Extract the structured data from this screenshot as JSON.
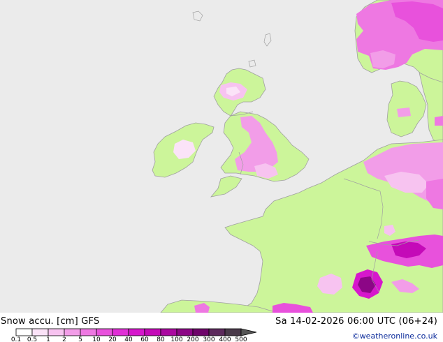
{
  "map": {
    "title_left": "Snow accu. [cm] GFS",
    "title_right": "Sa 14-02-2026 06:00 UTC (06+24)",
    "credit": "©weatheronline.co.uk"
  },
  "legend": {
    "values": [
      "0.1",
      "0.5",
      "1",
      "2",
      "5",
      "10",
      "20",
      "40",
      "60",
      "80",
      "100",
      "200",
      "300",
      "400",
      "500"
    ],
    "colors": [
      "#ffffff",
      "#fbe3f8",
      "#f7c3f0",
      "#f29de8",
      "#ee78e2",
      "#e851dc",
      "#e02fd6",
      "#d617cc",
      "#c40ab8",
      "#aa08a0",
      "#8c0686",
      "#6e046a",
      "#5c2a5c",
      "#4a3a4a",
      "#555555"
    ]
  },
  "colors": {
    "sea": "#ebebeb",
    "land": "#ccf59a",
    "coast": "#a0a0a0"
  }
}
